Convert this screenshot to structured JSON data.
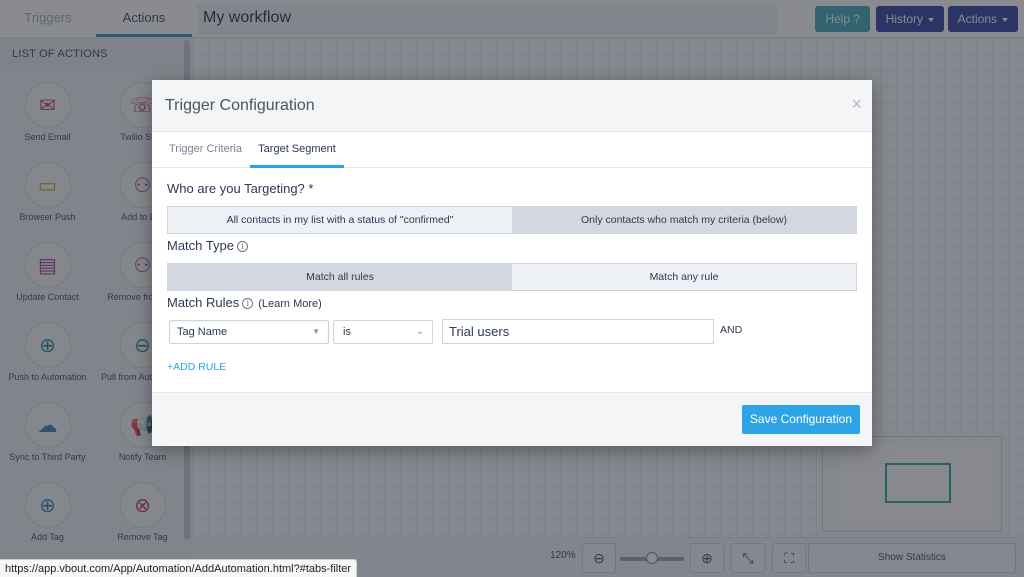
{
  "sidebar": {
    "tabs": [
      {
        "label": "Triggers",
        "active": false
      },
      {
        "label": "Actions",
        "active": true
      }
    ],
    "list_header": "LIST OF ACTIONS",
    "actions": [
      {
        "label": "Send Email",
        "icon": "send-email-icon",
        "glyph": "✉",
        "color": "#c43a5a"
      },
      {
        "label": "Twilio SMS",
        "icon": "sms-phone-icon",
        "glyph": "☏",
        "color": "#c43a5a"
      },
      {
        "label": "Browser Push",
        "icon": "browser-push-icon",
        "glyph": "▭",
        "color": "#d99a1a"
      },
      {
        "label": "Add to List",
        "icon": "add-user-icon",
        "glyph": "⚇",
        "color": "#b23a8a"
      },
      {
        "label": "Update Contact",
        "icon": "update-contact-icon",
        "glyph": "▤",
        "color": "#b23a8a"
      },
      {
        "label": "Remove from List",
        "icon": "remove-user-icon",
        "glyph": "⚇",
        "color": "#b23a8a"
      },
      {
        "label": "Push to Automation",
        "icon": "push-automation-icon",
        "glyph": "⊕",
        "color": "#1e8a8a"
      },
      {
        "label": "Pull from Automation",
        "icon": "pull-automation-icon",
        "glyph": "⊖",
        "color": "#1e8a8a"
      },
      {
        "label": "Sync to Third Party",
        "icon": "cloud-sync-icon",
        "glyph": "☁",
        "color": "#2f7fc4"
      },
      {
        "label": "Notify Team",
        "icon": "megaphone-icon",
        "glyph": "📢",
        "color": "#2f7fc4"
      },
      {
        "label": "Add Tag",
        "icon": "add-tag-icon",
        "glyph": "⊕",
        "color": "#2f7fc4"
      },
      {
        "label": "Remove Tag",
        "icon": "remove-tag-icon",
        "glyph": "⊗",
        "color": "#c43a5a"
      }
    ]
  },
  "topbar": {
    "workflow_title": "My workflow",
    "help_label": "Help ?",
    "history_label": "History",
    "actions_label": "Actions"
  },
  "bottombar": {
    "zoom_level": "120%",
    "zoom_slider_fraction": 0.5,
    "show_statistics_label": "Show Statistics"
  },
  "status_url": "https://app.vbout.com/App/Automation/AddAutomation.html?#tabs-filter",
  "modal": {
    "title": "Trigger Configuration",
    "close_glyph": "×",
    "tabs": [
      {
        "label": "Trigger Criteria",
        "active": false
      },
      {
        "label": "Target Segment",
        "active": true
      }
    ],
    "targeting": {
      "label": "Who are you Targeting? *",
      "options": [
        {
          "label": "All contacts in my list with a status of \"confirmed\"",
          "selected": false
        },
        {
          "label": "Only contacts who match my criteria (below)",
          "selected": true
        }
      ]
    },
    "match_type": {
      "label": "Match Type",
      "info_glyph": "i",
      "options": [
        {
          "label": "Match all rules",
          "selected": true
        },
        {
          "label": "Match any rule",
          "selected": false
        }
      ]
    },
    "match_rules": {
      "label": "Match Rules",
      "info_glyph": "i",
      "learn_more": "(Learn More)",
      "rules": [
        {
          "field": "Tag Name",
          "operator": "is",
          "value": "Trial users",
          "conjunction": "AND"
        }
      ],
      "add_rule_label": "+ADD RULE"
    },
    "save_label": "Save Configuration"
  },
  "colors": {
    "accent": "#2ea3e6",
    "nav_button": "#2f3f9e",
    "help_button": "#3ea6b6"
  }
}
